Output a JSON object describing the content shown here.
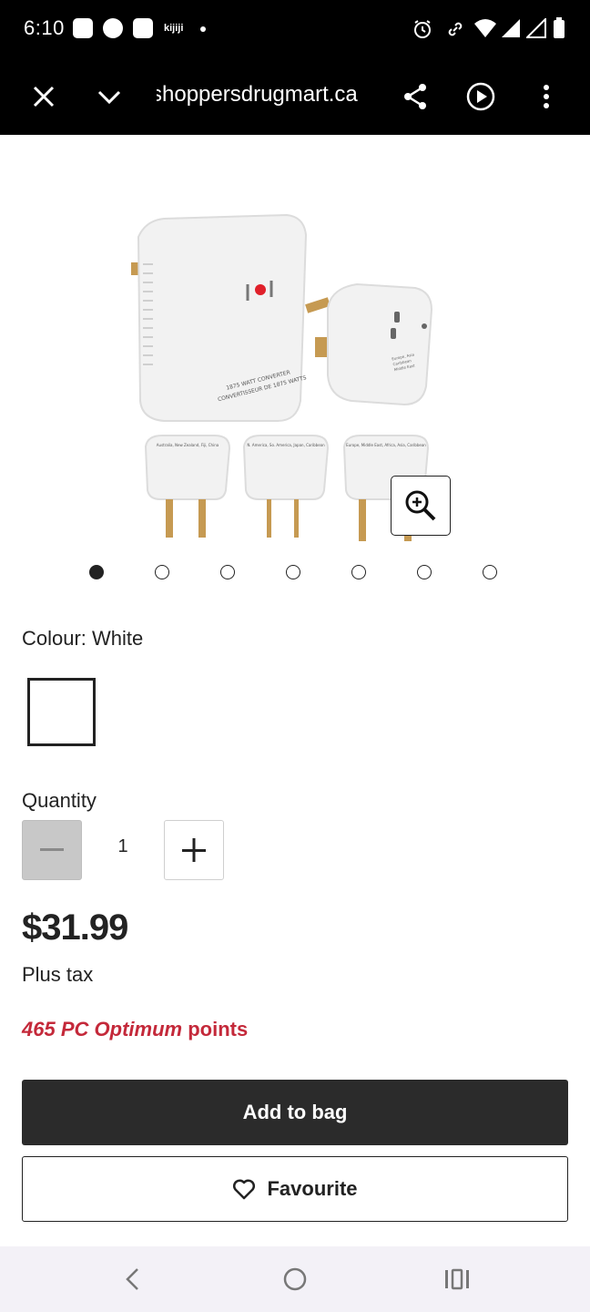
{
  "status_bar": {
    "time": "6:10",
    "notif_text": "kijiji"
  },
  "browser": {
    "url": "shoppersdrugmart.ca",
    "icons": [
      "close-icon",
      "chevron-down-icon",
      "share-icon",
      "play-icon",
      "more-vert-icon"
    ]
  },
  "gallery": {
    "total_images": 7,
    "active_index": 0,
    "plug_labels": [
      "Australia, New Zealand, Fiji, China",
      "N. America, So. America, Japan, Caribbean",
      "Europe, Middle East, Africa, Asia, Caribbean"
    ],
    "converter_label": "1875 WATT CONVERTER / CONVERTISSEUR DE 1875 WATTS"
  },
  "colour": {
    "label": "Colour: White",
    "swatch_color": "#ffffff"
  },
  "quantity": {
    "label": "Quantity",
    "value": "1"
  },
  "price": "$31.99",
  "tax_note": "Plus tax",
  "points": {
    "amount": "465",
    "brand": "PC Optimum",
    "suffix": "points"
  },
  "buttons": {
    "add_to_bag": "Add to bag",
    "favourite": "Favourite"
  },
  "colors": {
    "primary_dark": "#2b2b2b",
    "points_red": "#c4293a"
  }
}
